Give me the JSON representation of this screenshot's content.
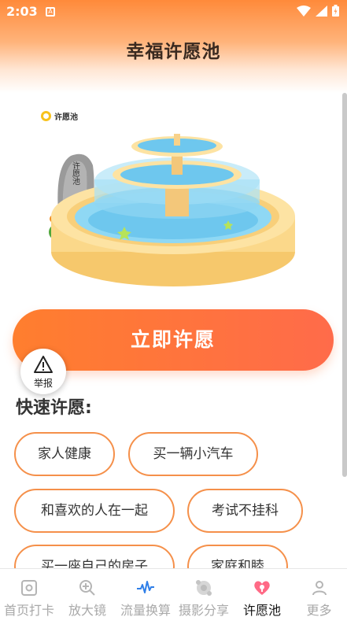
{
  "status": {
    "time": "2:03",
    "notif_glyph": "A"
  },
  "header": {
    "title": "幸福许愿池"
  },
  "badge": {
    "label": "许愿池"
  },
  "stone": {
    "text": "许愿池"
  },
  "primary_button": {
    "label": "立即许愿"
  },
  "report": {
    "label": "举报"
  },
  "quick": {
    "title": "快速许愿:",
    "chips": [
      "家人健康",
      "买一辆小汽车",
      "和喜欢的人在一起",
      "考试不挂科",
      "买一座自己的房子",
      "家庭和睦"
    ]
  },
  "tabbar": {
    "tabs": [
      {
        "label": "首页打卡",
        "icon": "camera-square-icon"
      },
      {
        "label": "放大镜",
        "icon": "magnifier-plus-icon"
      },
      {
        "label": "流量换算",
        "icon": "pulse-wave-icon"
      },
      {
        "label": "摄影分享",
        "icon": "share-nodes-icon"
      },
      {
        "label": "许愿池",
        "icon": "wish-heart-icon",
        "active": true
      },
      {
        "label": "更多",
        "icon": "person-icon"
      }
    ]
  },
  "colors": {
    "accent": "#ff7e2e",
    "chip_border": "#f5904a",
    "header_top": "#ff8a3a"
  }
}
